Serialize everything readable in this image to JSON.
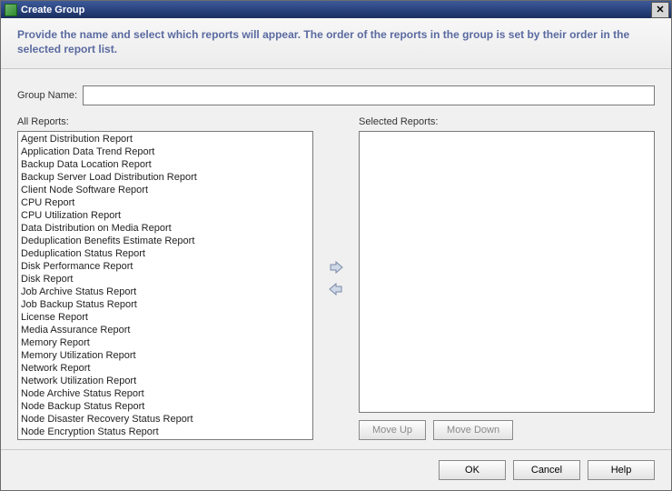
{
  "window": {
    "title": "Create Group"
  },
  "instruction": "Provide the name and select which reports will appear.  The order of the reports in the group is set by their order in the selected report list.",
  "group_name": {
    "label": "Group Name:",
    "value": ""
  },
  "labels": {
    "all_reports": "All Reports:",
    "selected_reports": "Selected Reports:"
  },
  "all_reports": [
    "Agent Distribution Report",
    "Application Data Trend Report",
    "Backup Data Location Report",
    "Backup Server Load Distribution Report",
    "Client Node Software Report",
    "CPU Report",
    "CPU Utilization Report",
    "Data Distribution on Media Report",
    "Deduplication Benefits Estimate Report",
    "Deduplication Status Report",
    "Disk Performance Report",
    "Disk Report",
    "Job Archive Status Report",
    "Job Backup Status Report",
    "License Report",
    "Media Assurance Report",
    "Memory Report",
    "Memory Utilization Report",
    "Network Report",
    "Network Utilization Report",
    "Node Archive Status Report",
    "Node Backup Status Report",
    "Node Disaster Recovery Status Report",
    "Node Encryption Status Report"
  ],
  "selected_reports": [],
  "buttons": {
    "move_up": "Move Up",
    "move_down": "Move Down",
    "ok": "OK",
    "cancel": "Cancel",
    "help": "Help"
  }
}
